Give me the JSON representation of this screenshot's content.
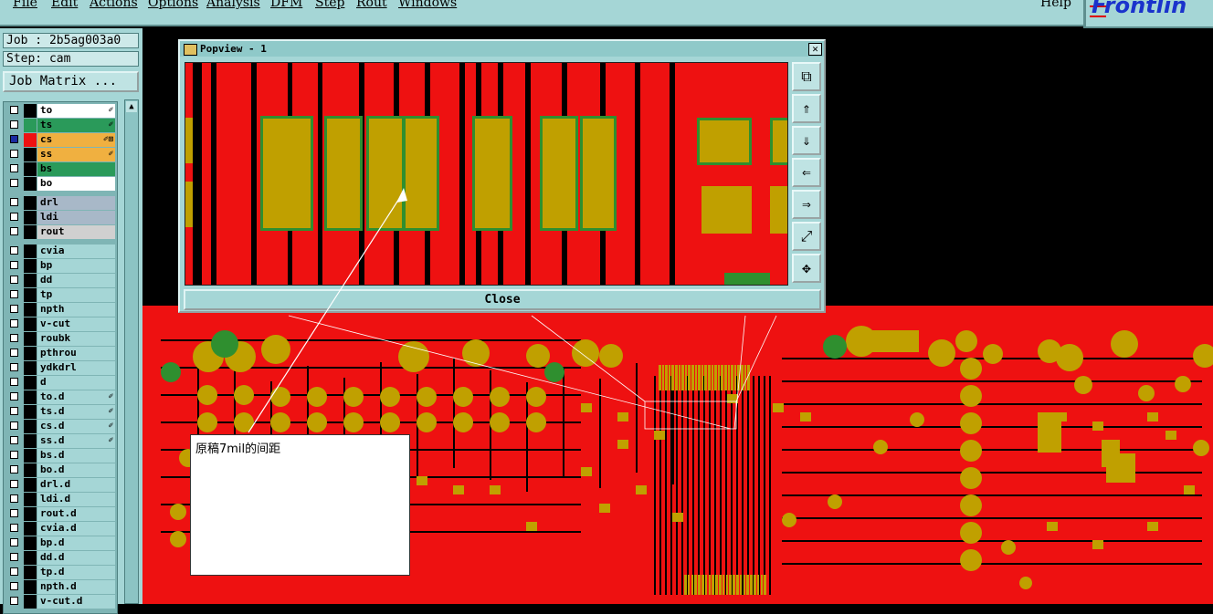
{
  "menu": {
    "items": [
      "File",
      "Edit",
      "Actions",
      "Options",
      "Analysis",
      "DFM",
      "Step",
      "Rout",
      "Windows"
    ],
    "help": "Help"
  },
  "logo": {
    "text": "Frontlin"
  },
  "job": {
    "label": "Job : 2b5ag003a0",
    "step": "Step: cam",
    "matrix_button": "Job Matrix ..."
  },
  "layers": [
    {
      "name": "to",
      "color": "#000000",
      "bg": "#ffffff",
      "mark": "✐"
    },
    {
      "name": "ts",
      "color": "#2a9a5a",
      "bg": "#2a9a5a",
      "mark": "✐"
    },
    {
      "name": "cs",
      "color": "#ee1111",
      "bg": "#f0b040",
      "mark": "✐⊞",
      "selected": true
    },
    {
      "name": "ss",
      "color": "#000000",
      "bg": "#f0b040",
      "mark": "✐"
    },
    {
      "name": "bs",
      "color": "#000000",
      "bg": "#2a9a5a",
      "mark": ""
    },
    {
      "name": "bo",
      "color": "#000000",
      "bg": "#ffffff",
      "mark": ""
    },
    {
      "name": "drl",
      "color": "#000000",
      "bg": "#a8b8c8",
      "mark": ""
    },
    {
      "name": "ldi",
      "color": "#000000",
      "bg": "#a8b8c8",
      "mark": ""
    },
    {
      "name": "rout",
      "color": "#000000",
      "bg": "#d0d0d0",
      "mark": ""
    },
    {
      "name": "cvia",
      "color": "#000000",
      "bg": "#a5d6d6",
      "mark": ""
    },
    {
      "name": "bp",
      "color": "#000000",
      "bg": "#a5d6d6",
      "mark": ""
    },
    {
      "name": "dd",
      "color": "#000000",
      "bg": "#a5d6d6",
      "mark": ""
    },
    {
      "name": "tp",
      "color": "#000000",
      "bg": "#a5d6d6",
      "mark": ""
    },
    {
      "name": "npth",
      "color": "#000000",
      "bg": "#a5d6d6",
      "mark": ""
    },
    {
      "name": "v-cut",
      "color": "#000000",
      "bg": "#a5d6d6",
      "mark": ""
    },
    {
      "name": "roubk",
      "color": "#000000",
      "bg": "#a5d6d6",
      "mark": ""
    },
    {
      "name": "pthrou",
      "color": "#000000",
      "bg": "#a5d6d6",
      "mark": ""
    },
    {
      "name": "ydkdrl",
      "color": "#000000",
      "bg": "#a5d6d6",
      "mark": ""
    },
    {
      "name": "d",
      "color": "#000000",
      "bg": "#a5d6d6",
      "mark": ""
    },
    {
      "name": "to.d",
      "color": "#000000",
      "bg": "#a5d6d6",
      "mark": "✐"
    },
    {
      "name": "ts.d",
      "color": "#000000",
      "bg": "#a5d6d6",
      "mark": "✐"
    },
    {
      "name": "cs.d",
      "color": "#000000",
      "bg": "#a5d6d6",
      "mark": "✐"
    },
    {
      "name": "ss.d",
      "color": "#000000",
      "bg": "#a5d6d6",
      "mark": "✐"
    },
    {
      "name": "bs.d",
      "color": "#000000",
      "bg": "#a5d6d6",
      "mark": ""
    },
    {
      "name": "bo.d",
      "color": "#000000",
      "bg": "#a5d6d6",
      "mark": ""
    },
    {
      "name": "drl.d",
      "color": "#000000",
      "bg": "#a5d6d6",
      "mark": ""
    },
    {
      "name": "ldi.d",
      "color": "#000000",
      "bg": "#a5d6d6",
      "mark": ""
    },
    {
      "name": "rout.d",
      "color": "#000000",
      "bg": "#a5d6d6",
      "mark": ""
    },
    {
      "name": "cvia.d",
      "color": "#000000",
      "bg": "#a5d6d6",
      "mark": ""
    },
    {
      "name": "bp.d",
      "color": "#000000",
      "bg": "#a5d6d6",
      "mark": ""
    },
    {
      "name": "dd.d",
      "color": "#000000",
      "bg": "#a5d6d6",
      "mark": ""
    },
    {
      "name": "tp.d",
      "color": "#000000",
      "bg": "#a5d6d6",
      "mark": ""
    },
    {
      "name": "npth.d",
      "color": "#000000",
      "bg": "#a5d6d6",
      "mark": ""
    },
    {
      "name": "v-cut.d",
      "color": "#000000",
      "bg": "#a5d6d6",
      "mark": ""
    }
  ],
  "popview": {
    "title": "Popview - 1",
    "close_label": "Close",
    "buttons": [
      "zoom-fit-icon",
      "pan-up-icon",
      "pan-down-icon",
      "pan-left-icon",
      "pan-right-icon",
      "zoom-out-icon",
      "zoom-in-icon"
    ]
  },
  "note": {
    "text": "原稿7mil的间距"
  },
  "colors": {
    "panel": "#a5d6d6",
    "copper": "#ee1111",
    "pad": "#c0a000"
  }
}
